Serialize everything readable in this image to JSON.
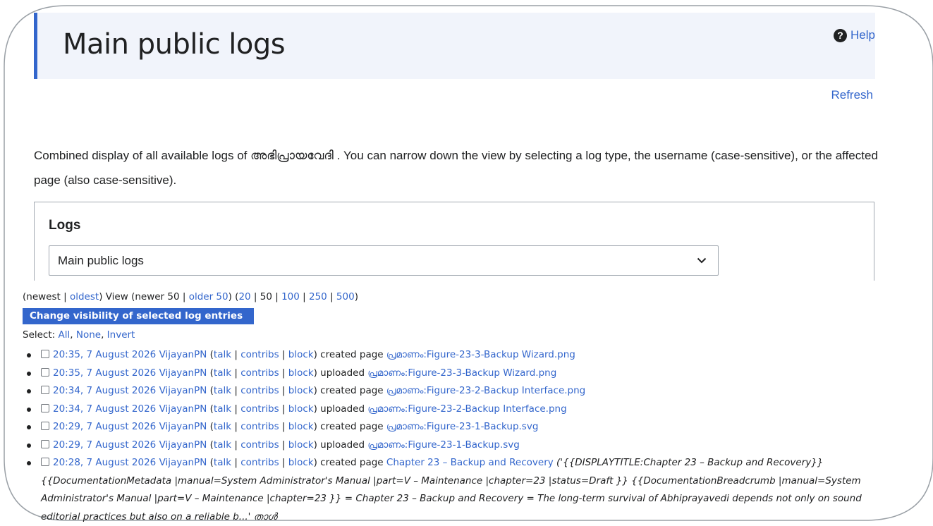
{
  "header": {
    "title": "Main public logs",
    "help_label": "Help"
  },
  "refresh_label": "Refresh",
  "intro": {
    "before": "Combined display of all available logs of ",
    "site_name": "അഭിപ്രായവേദി",
    "after": " . You can narrow down the view by selecting a log type, the username (case-sensitive), or the affected page (also case-sensitive)."
  },
  "logs_form": {
    "heading": "Logs",
    "selected": "Main public logs"
  },
  "nav": {
    "open": "(",
    "newest": "newest",
    "sep1": " | ",
    "oldest": "oldest",
    "view": ") View (newer 50 | ",
    "older": "older 50",
    "mid": ") (",
    "n20": "20",
    "sep_a": " | 50 | ",
    "n100": "100",
    "sep_b": " | ",
    "n250": "250",
    "sep_c": " | ",
    "n500": "500",
    "close": ")"
  },
  "visibility_button": "Change visibility of selected log entries",
  "select": {
    "label": "Select: ",
    "all": "All",
    "c1": ", ",
    "none": "None",
    "c2": ", ",
    "invert": "Invert"
  },
  "entries": [
    {
      "time": "20:35, 7 August 2026",
      "user": "VijayanPN",
      "action": "created page",
      "target": "പ്രമാണം:Figure-23-3-Backup Wizard.png"
    },
    {
      "time": "20:35, 7 August 2026",
      "user": "VijayanPN",
      "action": "uploaded",
      "target": "പ്രമാണം:Figure-23-3-Backup Wizard.png"
    },
    {
      "time": "20:34, 7 August 2026",
      "user": "VijayanPN",
      "action": "created page",
      "target": "പ്രമാണം:Figure-23-2-Backup Interface.png"
    },
    {
      "time": "20:34, 7 August 2026",
      "user": "VijayanPN",
      "action": "uploaded",
      "target": "പ്രമാണം:Figure-23-2-Backup Interface.png"
    },
    {
      "time": "20:29, 7 August 2026",
      "user": "VijayanPN",
      "action": "created page",
      "target": "പ്രമാണം:Figure-23-1-Backup.svg"
    },
    {
      "time": "20:29, 7 August 2026",
      "user": "VijayanPN",
      "action": "uploaded",
      "target": "പ്രമാണം:Figure-23-1-Backup.svg"
    },
    {
      "time": "20:28, 7 August 2026",
      "user": "VijayanPN",
      "action": "created page",
      "target": "Chapter 23 – Backup and Recovery",
      "comment": "('{{DISPLAYTITLE:Chapter 23 – Backup and Recovery}} {{DocumentationMetadata |manual=System Administrator's Manual |part=V – Maintenance |chapter=23 |status=Draft }} {{DocumentationBreadcrumb |manual=System Administrator's Manual |part=V – Maintenance |chapter=23 }} = Chapter 23 – Backup and Recovery = The long-term survival of Abhiprayavedi depends not only on sound editorial practices but also on a reliable b...' താൾ"
    }
  ],
  "user_links": {
    "talk": "talk",
    "contribs": "contribs",
    "block": "block"
  },
  "colors": {
    "link": "#3366cc",
    "header_bg": "#f1f4fb",
    "accent": "#3366cc",
    "text": "#202122"
  }
}
